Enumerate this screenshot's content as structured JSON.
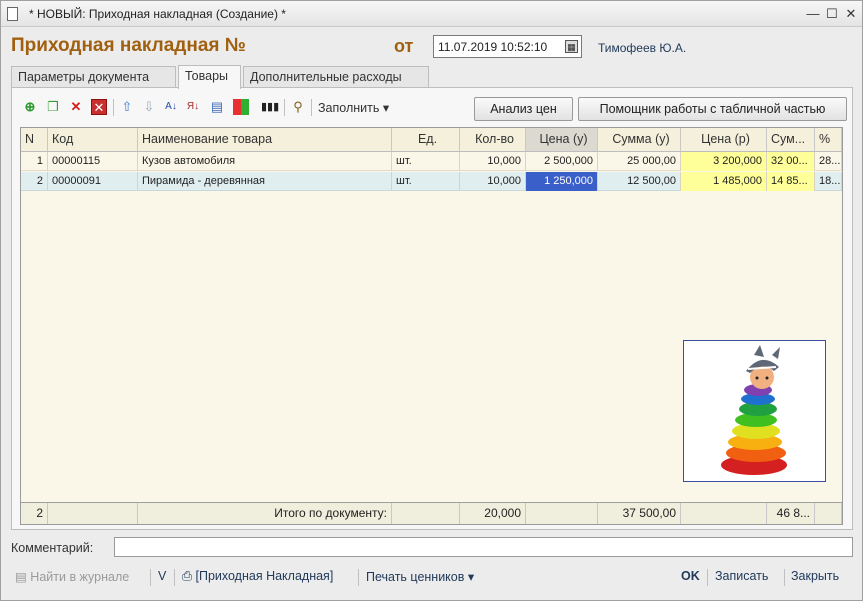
{
  "window": {
    "title": "* НОВЫЙ: Приходная накладная (Создание) *"
  },
  "header": {
    "title": "Приходная накладная №",
    "from_label": "от",
    "date": "11.07.2019 10:52:10",
    "user": "Тимофеев Ю.А."
  },
  "tabs": [
    "Параметры документа",
    "Товары",
    "Дополнительные расходы"
  ],
  "toolbar": {
    "fill_label": "Заполнить",
    "price_analysis": "Анализ цен",
    "table_helper": "Помощник работы с табличной частью"
  },
  "table": {
    "columns": [
      "N",
      "Код",
      "Наименование товара",
      "Ед.",
      "Кол-во",
      "Цена (у)",
      "Сумма (у)",
      "Цена (р)",
      "Сум...",
      "%"
    ],
    "rows": [
      [
        "1",
        "00000115",
        "Кузов автомобиля",
        "шт.",
        "10,000",
        "2 500,000",
        "25 000,00",
        "3 200,000",
        "32 00...",
        "28..."
      ],
      [
        "2",
        "00000091",
        "Пирамида - деревянная",
        "шт.",
        "10,000",
        "1 250,000",
        "12 500,00",
        "1 485,000",
        "14 85...",
        "18..."
      ]
    ],
    "footer": {
      "count": "2",
      "label": "Итого по документу:",
      "qty": "20,000",
      "sum_u": "37 500,00",
      "sum_r": "46 8..."
    }
  },
  "comment": {
    "label": "Комментарий:",
    "value": ""
  },
  "bottom": {
    "find_journal": "Найти в журнале",
    "v": "V",
    "print_doc": "[Приходная Накладная]",
    "print_tags": "Печать ценников",
    "ok": "OK",
    "save": "Записать",
    "close": "Закрыть"
  }
}
